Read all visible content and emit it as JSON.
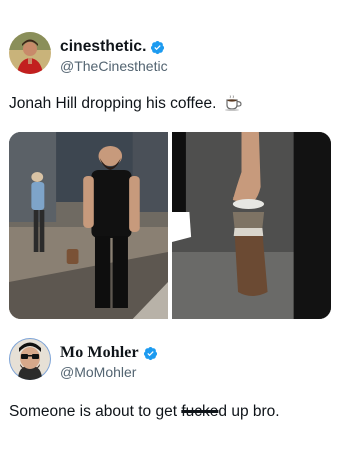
{
  "post1": {
    "display_name": "cinesthetic.",
    "handle": "@TheCinesthetic",
    "text": "Jonah Hill dropping his coffee.",
    "text_emoji_icon": "coffee-cup-icon",
    "media": [
      {
        "icon": "street-photo"
      },
      {
        "icon": "coffee-cup-drop-photo"
      }
    ]
  },
  "post2": {
    "display_name": "Mo Mohler",
    "handle": "@MoMohler",
    "text_before": "Someone is about to get ",
    "text_struck": "fucke",
    "text_after": "d up bro."
  },
  "colors": {
    "verified": "#1d9bf0",
    "handle": "#536471",
    "text": "#0f1419"
  }
}
